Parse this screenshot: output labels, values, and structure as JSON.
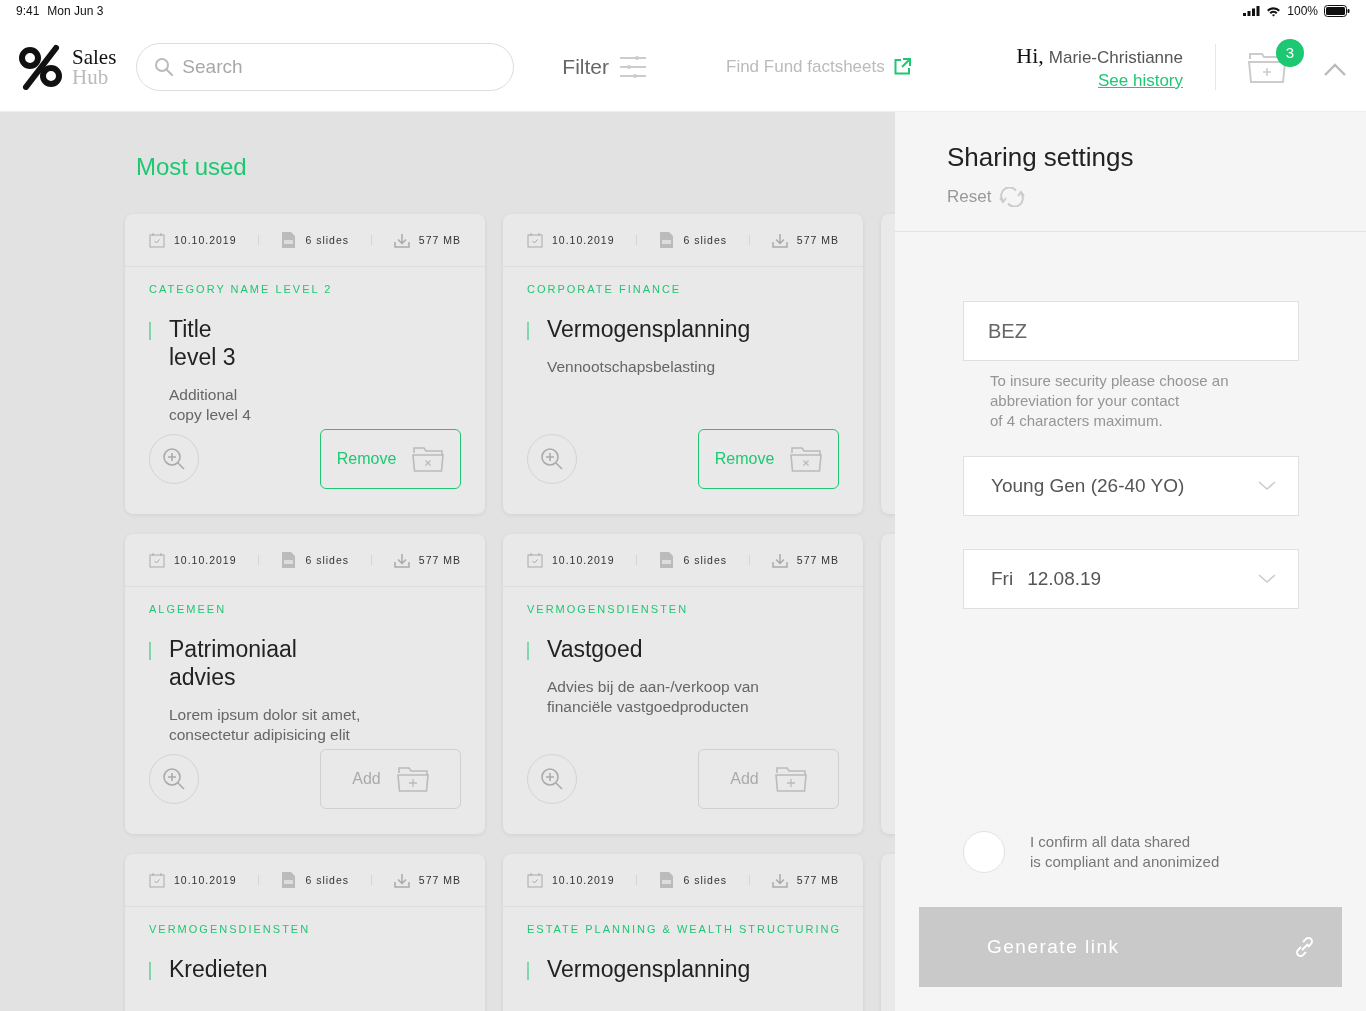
{
  "status_bar": {
    "time": "9:41",
    "date": "Mon Jun 3",
    "battery": "100%"
  },
  "header": {
    "logo": {
      "line_1": "Sales",
      "line_2": "Hub"
    },
    "search": {
      "placeholder": "Search"
    },
    "filter": "Filter",
    "factsheets_link": "Find Fund factsheets",
    "greeting": "Hi,",
    "user_name": "Marie-Christianne",
    "history_link": "See history",
    "cart_badge": "3"
  },
  "section_title": "Most used",
  "cards": [
    {
      "date": "10.10.2019",
      "slides": "6 slides",
      "size": "577 MB",
      "category": "CATEGORY NAME LEVEL 2",
      "title": "Title\nlevel 3",
      "description": "Additional\ncopy level 4",
      "action": {
        "kind": "remove",
        "label": "Remove"
      }
    },
    {
      "date": "10.10.2019",
      "slides": "6 slides",
      "size": "577 MB",
      "category": "CORPORATE FINANCE",
      "title": "Vermogensplanning",
      "description": "Vennootschapsbelasting",
      "action": {
        "kind": "remove",
        "label": "Remove"
      }
    },
    {
      "date": "10.10.2019",
      "slides": "6 slides",
      "size": "577 MB",
      "category": "ALGEMEEN",
      "title": "Patrimoniaal\nadvies",
      "description": "Lorem ipsum dolor sit amet,\nconsectetur adipisicing elit",
      "action": {
        "kind": "add",
        "label": "Add"
      }
    },
    {
      "date": "10.10.2019",
      "slides": "6 slides",
      "size": "577 MB",
      "category": "VERMOGENSDIENSTEN",
      "title": "Vastgoed",
      "description": "Advies bij de aan-/verkoop van\nfinanciële vastgoedproducten",
      "action": {
        "kind": "add",
        "label": "Add"
      }
    },
    {
      "date": "10.10.2019",
      "slides": "6 slides",
      "size": "577 MB",
      "category": "VERMOGENSDIENSTEN",
      "title": "Kredieten"
    },
    {
      "date": "10.10.2019",
      "slides": "6 slides",
      "size": "577 MB",
      "category": "ESTATE PLANNING & WEALTH STRUCTURING",
      "title": "Vermogensplanning"
    }
  ],
  "sharing": {
    "title": "Sharing settings",
    "reset": "Reset",
    "abbreviation": {
      "value": "BEZ"
    },
    "hint": "To insure security please choose an\nabbreviation for your contact\nof 4 characters maximum.",
    "audience": {
      "value": "Young Gen (26-40 YO)"
    },
    "date": {
      "day": "Fri",
      "value": "12.08.19"
    },
    "confirm": {
      "label": "I confirm all data shared\nis compliant and anonimized",
      "checked": false
    },
    "generate": {
      "label": "Generate link",
      "disabled": true
    }
  }
}
